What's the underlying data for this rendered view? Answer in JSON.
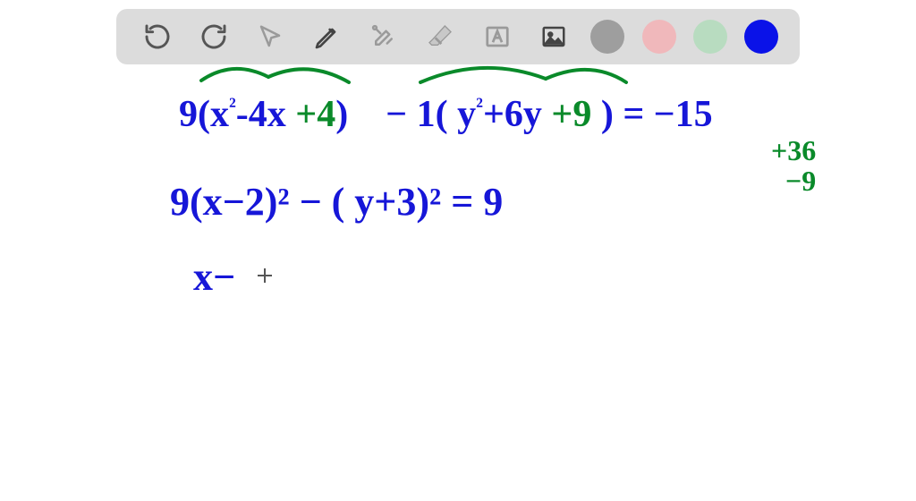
{
  "toolbar": {
    "tools": [
      {
        "name": "undo-icon",
        "title": "Undo"
      },
      {
        "name": "redo-icon",
        "title": "Redo"
      },
      {
        "name": "pointer-icon",
        "title": "Select"
      },
      {
        "name": "pencil-icon",
        "title": "Draw"
      },
      {
        "name": "tools-icon",
        "title": "Tools"
      },
      {
        "name": "eraser-icon",
        "title": "Erase"
      },
      {
        "name": "textbox-icon",
        "title": "Text"
      },
      {
        "name": "image-icon",
        "title": "Image"
      }
    ],
    "colors": {
      "gray": "#9e9e9e",
      "pink": "#f0b8bb",
      "mint": "#b8dcc0",
      "blue": "#0a12e8"
    },
    "active_color": "blue"
  },
  "handwriting": {
    "line1": {
      "a": "9(x",
      "b": "²",
      "c": "-4x",
      "d": "+4",
      "e": ")",
      "f": "− 1( y",
      "g": "²",
      "h": "+6y",
      "i": "+9",
      "j": ") = −15"
    },
    "side": {
      "p1": "+36",
      "p2": "−9"
    },
    "line2": "9(x−2)² − ( y+3)² = 9",
    "line3": "x−"
  },
  "ink_colors": {
    "blue": "#1616d8",
    "green": "#0a8a2a"
  }
}
